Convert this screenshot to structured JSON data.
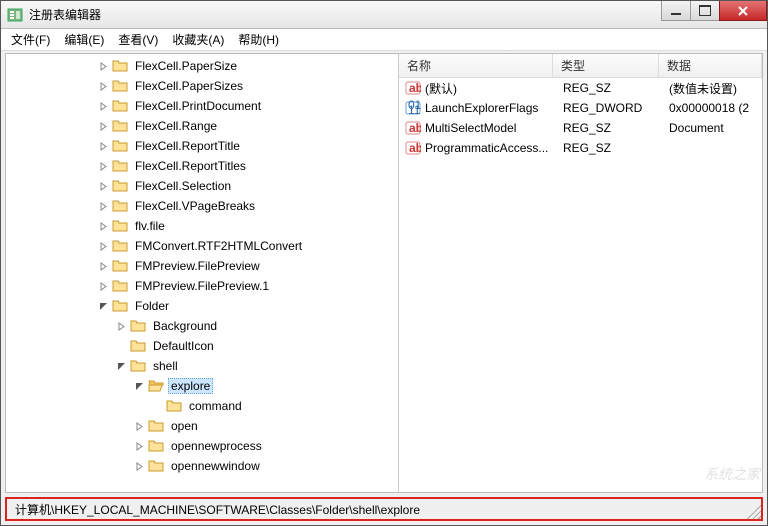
{
  "window": {
    "title": "注册表编辑器"
  },
  "menu": {
    "file": "文件(F)",
    "edit": "编辑(E)",
    "view": "查看(V)",
    "favorites": "收藏夹(A)",
    "help": "帮助(H)"
  },
  "list": {
    "columns": {
      "name": "名称",
      "type": "类型",
      "data": "数据"
    },
    "rows": [
      {
        "icon": "str",
        "name": "(默认)",
        "type": "REG_SZ",
        "data": "(数值未设置)"
      },
      {
        "icon": "bin",
        "name": "LaunchExplorerFlags",
        "type": "REG_DWORD",
        "data": "0x00000018 (2"
      },
      {
        "icon": "str",
        "name": "MultiSelectModel",
        "type": "REG_SZ",
        "data": "Document"
      },
      {
        "icon": "str",
        "name": "ProgrammaticAccess...",
        "type": "REG_SZ",
        "data": ""
      }
    ]
  },
  "tree": [
    {
      "d": 5,
      "t": "r",
      "label": "FlexCell.PaperSize"
    },
    {
      "d": 5,
      "t": "r",
      "label": "FlexCell.PaperSizes"
    },
    {
      "d": 5,
      "t": "r",
      "label": "FlexCell.PrintDocument"
    },
    {
      "d": 5,
      "t": "r",
      "label": "FlexCell.Range"
    },
    {
      "d": 5,
      "t": "r",
      "label": "FlexCell.ReportTitle"
    },
    {
      "d": 5,
      "t": "r",
      "label": "FlexCell.ReportTitles"
    },
    {
      "d": 5,
      "t": "r",
      "label": "FlexCell.Selection"
    },
    {
      "d": 5,
      "t": "r",
      "label": "FlexCell.VPageBreaks"
    },
    {
      "d": 5,
      "t": "r",
      "label": "flv.file"
    },
    {
      "d": 5,
      "t": "r",
      "label": "FMConvert.RTF2HTMLConvert"
    },
    {
      "d": 5,
      "t": "r",
      "label": "FMPreview.FilePreview"
    },
    {
      "d": 5,
      "t": "r",
      "label": "FMPreview.FilePreview.1"
    },
    {
      "d": 5,
      "t": "d",
      "label": "Folder"
    },
    {
      "d": 6,
      "t": "r",
      "label": "Background"
    },
    {
      "d": 6,
      "t": "n",
      "label": "DefaultIcon"
    },
    {
      "d": 6,
      "t": "d",
      "label": "shell"
    },
    {
      "d": 7,
      "t": "d",
      "label": "explore",
      "sel": true,
      "open": true
    },
    {
      "d": 8,
      "t": "n",
      "label": "command"
    },
    {
      "d": 7,
      "t": "r",
      "label": "open"
    },
    {
      "d": 7,
      "t": "r",
      "label": "opennewprocess"
    },
    {
      "d": 7,
      "t": "r",
      "label": "opennewwindow"
    }
  ],
  "status": {
    "path": "计算机\\HKEY_LOCAL_MACHINE\\SOFTWARE\\Classes\\Folder\\shell\\explore"
  },
  "watermark": "系统之家"
}
